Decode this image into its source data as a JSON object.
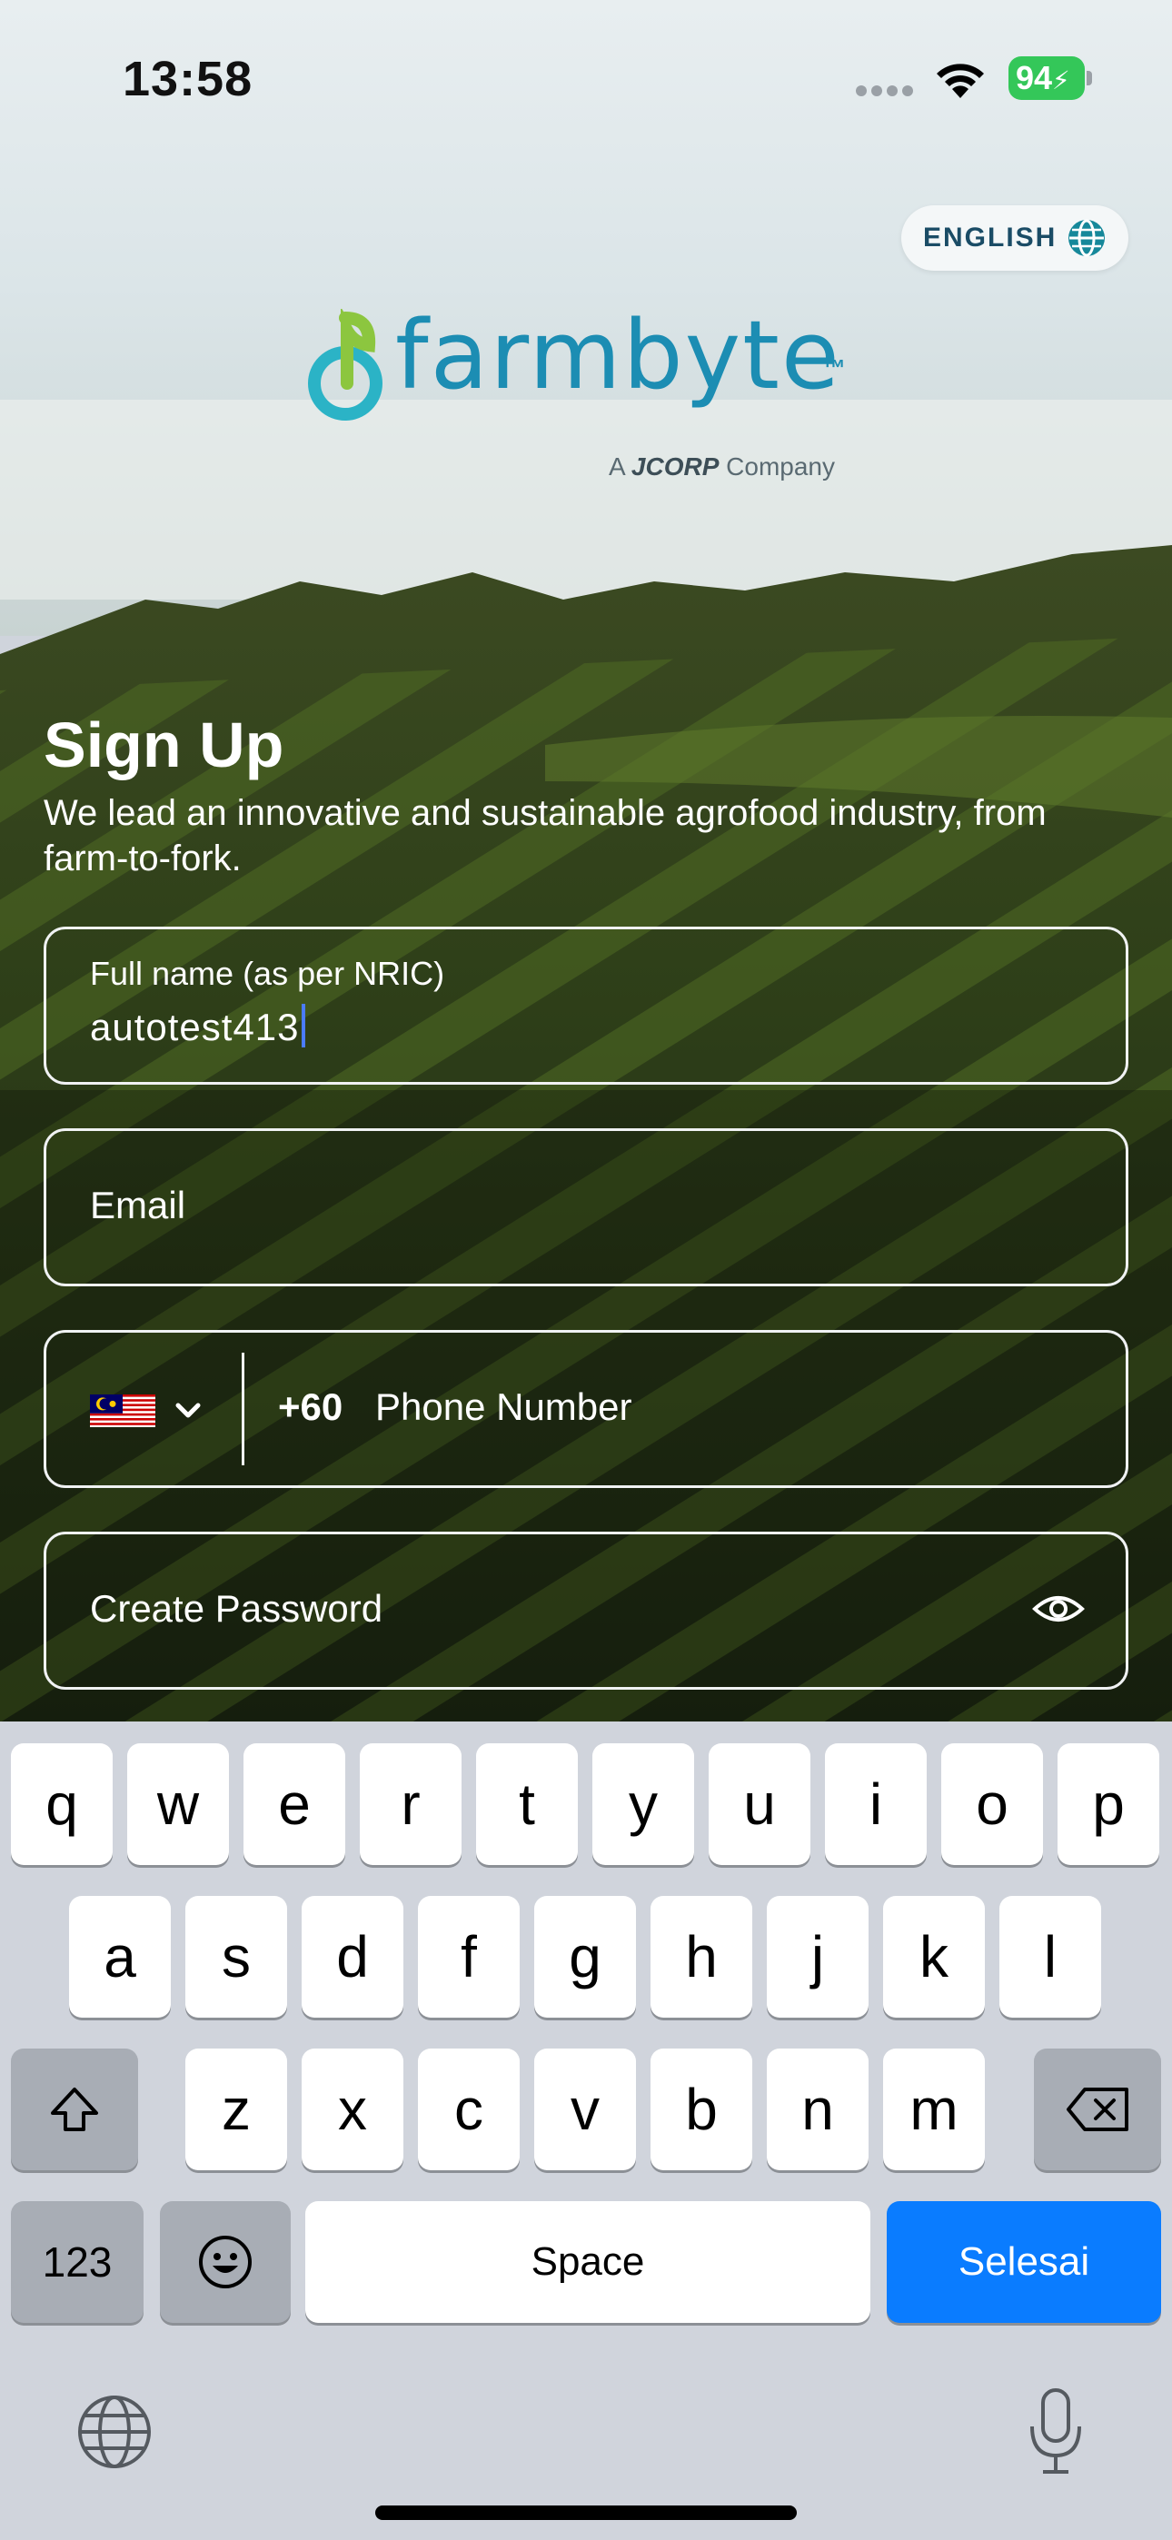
{
  "status_bar": {
    "time": "13:58",
    "battery": "94"
  },
  "language": {
    "label": "ENGLISH"
  },
  "logo": {
    "word": "farmbyte",
    "tm": "™",
    "prefix": "A",
    "company_brand": "JCORP",
    "suffix": "Company"
  },
  "signup": {
    "title": "Sign Up",
    "subtitle": "We lead an innovative and sustainable agrofood industry, from farm-to-fork."
  },
  "form": {
    "full_name": {
      "label": "Full name (as per NRIC)",
      "value": "autotest413"
    },
    "email": {
      "placeholder": "Email"
    },
    "phone": {
      "dial_code": "+60",
      "placeholder": "Phone Number",
      "country_flag": "malaysia-flag"
    },
    "password": {
      "placeholder": "Create Password"
    }
  },
  "keyboard": {
    "row1": [
      "q",
      "w",
      "e",
      "r",
      "t",
      "y",
      "u",
      "i",
      "o",
      "p"
    ],
    "row2": [
      "a",
      "s",
      "d",
      "f",
      "g",
      "h",
      "j",
      "k",
      "l"
    ],
    "row3": [
      "z",
      "x",
      "c",
      "v",
      "b",
      "n",
      "m"
    ],
    "numbers_key": "123",
    "space_key": "Space",
    "return_key": "Selesai"
  },
  "colors": {
    "accent_blue": "#0a7cff",
    "brand_teal": "#1c8db3",
    "battery_green": "#34c759"
  }
}
